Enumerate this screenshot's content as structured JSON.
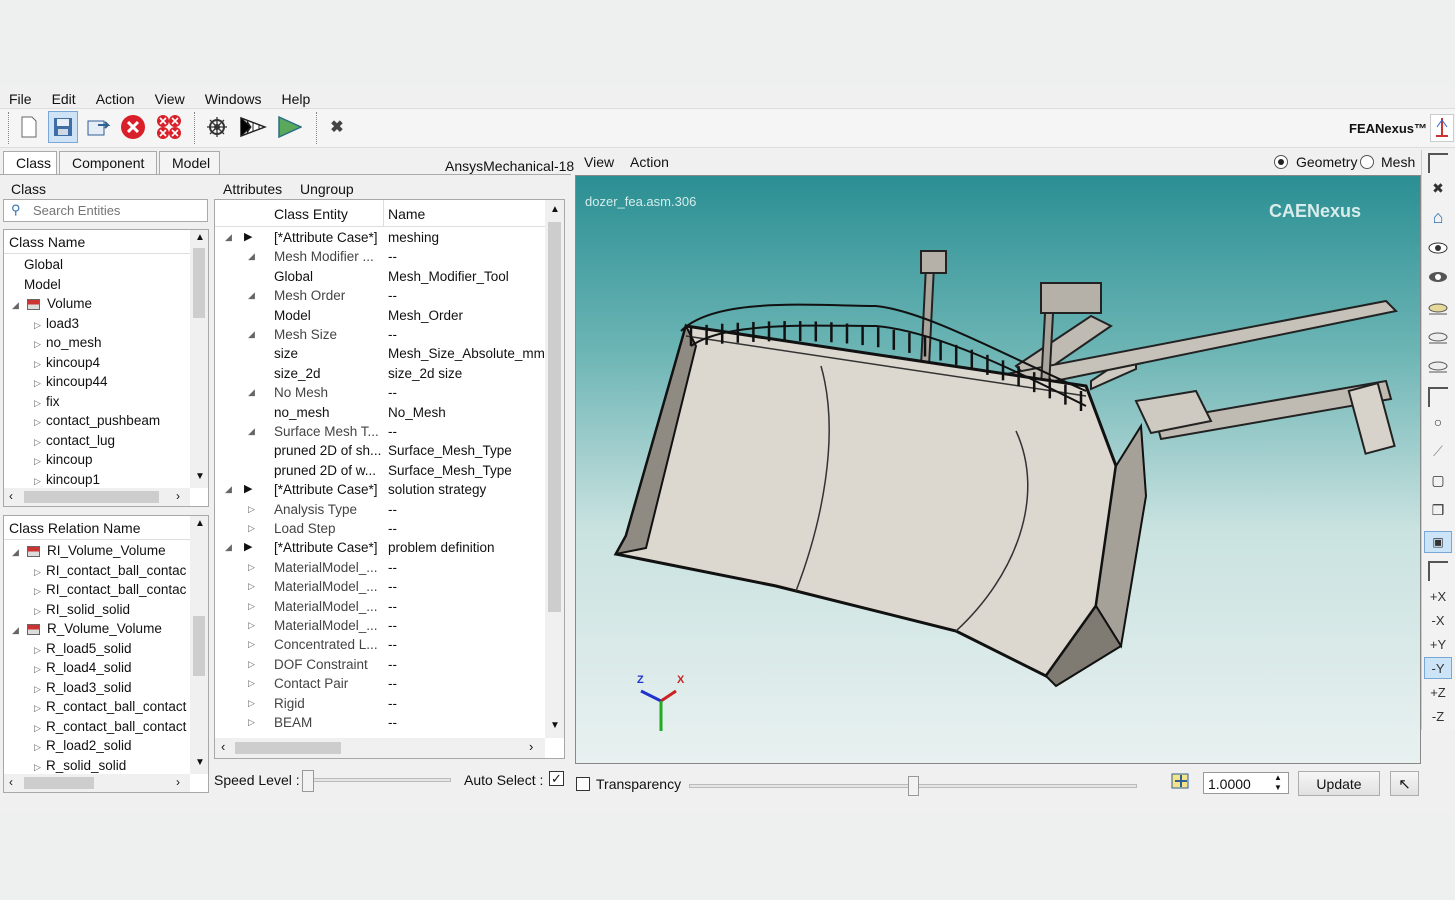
{
  "menu": [
    "File",
    "Edit",
    "Action",
    "View",
    "Windows",
    "Help"
  ],
  "brand": "FEANexus™",
  "tabs": [
    "Class",
    "Component",
    "Model"
  ],
  "solver": "AnsysMechanical-18",
  "class_panel": {
    "title": "Class",
    "search_placeholder": "Search Entities",
    "header": "Class Name",
    "items": [
      {
        "label": "Global",
        "level": 1,
        "expander": ""
      },
      {
        "label": "Model",
        "level": 1,
        "expander": ""
      },
      {
        "label": "Volume",
        "level": 1,
        "expander": "open",
        "icon": true
      },
      {
        "label": "load3",
        "level": 2,
        "expander": "closed"
      },
      {
        "label": "no_mesh",
        "level": 2,
        "expander": "closed"
      },
      {
        "label": "kincoup4",
        "level": 2,
        "expander": "closed"
      },
      {
        "label": "kincoup44",
        "level": 2,
        "expander": "closed"
      },
      {
        "label": "fix",
        "level": 2,
        "expander": "closed"
      },
      {
        "label": "contact_pushbeam",
        "level": 2,
        "expander": "closed"
      },
      {
        "label": "contact_lug",
        "level": 2,
        "expander": "closed"
      },
      {
        "label": "kincoup",
        "level": 2,
        "expander": "closed"
      },
      {
        "label": "kincoup1",
        "level": 2,
        "expander": "closed"
      }
    ]
  },
  "relation_panel": {
    "header": "Class Relation Name",
    "items": [
      {
        "label": "RI_Volume_Volume",
        "level": 1,
        "expander": "open",
        "icon": true
      },
      {
        "label": "RI_contact_ball_contac",
        "level": 2,
        "expander": "closed"
      },
      {
        "label": "RI_contact_ball_contac",
        "level": 2,
        "expander": "closed"
      },
      {
        "label": "RI_solid_solid",
        "level": 2,
        "expander": "closed"
      },
      {
        "label": "R_Volume_Volume",
        "level": 1,
        "expander": "open",
        "icon": true
      },
      {
        "label": "R_load5_solid",
        "level": 2,
        "expander": "closed"
      },
      {
        "label": "R_load4_solid",
        "level": 2,
        "expander": "closed"
      },
      {
        "label": "R_load3_solid",
        "level": 2,
        "expander": "closed"
      },
      {
        "label": "R_contact_ball_contact",
        "level": 2,
        "expander": "closed"
      },
      {
        "label": "R_contact_ball_contact",
        "level": 2,
        "expander": "closed"
      },
      {
        "label": "R_load2_solid",
        "level": 2,
        "expander": "closed"
      },
      {
        "label": "R_solid_solid",
        "level": 2,
        "expander": "closed"
      }
    ]
  },
  "attr_panel": {
    "menu": [
      "Attributes",
      "Ungroup"
    ],
    "col1": "Class Entity",
    "col2": "Name",
    "rows": [
      {
        "entity": "[*Attribute Case*]",
        "name": "meshing",
        "level": 0,
        "expander": "open",
        "play": true
      },
      {
        "entity": "Mesh Modifier ...",
        "name": "--",
        "level": 1,
        "expander": "open",
        "gray": true
      },
      {
        "entity": "Global",
        "name": "Mesh_Modifier_Tool",
        "level": 2,
        "expander": ""
      },
      {
        "entity": "Mesh Order",
        "name": "--",
        "level": 1,
        "expander": "open",
        "gray": true
      },
      {
        "entity": "Model",
        "name": "Mesh_Order",
        "level": 2,
        "expander": ""
      },
      {
        "entity": "Mesh Size",
        "name": "--",
        "level": 1,
        "expander": "open",
        "gray": true
      },
      {
        "entity": "size",
        "name": "Mesh_Size_Absolute_mm",
        "level": 2,
        "expander": ""
      },
      {
        "entity": "size_2d",
        "name": "size_2d size",
        "level": 2,
        "expander": ""
      },
      {
        "entity": "No Mesh",
        "name": "--",
        "level": 1,
        "expander": "open",
        "gray": true
      },
      {
        "entity": "no_mesh",
        "name": "No_Mesh",
        "level": 2,
        "expander": ""
      },
      {
        "entity": "Surface Mesh T...",
        "name": "--",
        "level": 1,
        "expander": "open",
        "gray": true
      },
      {
        "entity": "pruned 2D of sh...",
        "name": "Surface_Mesh_Type",
        "level": 2,
        "expander": ""
      },
      {
        "entity": "pruned 2D of w...",
        "name": "Surface_Mesh_Type",
        "level": 2,
        "expander": ""
      },
      {
        "entity": "[*Attribute Case*]",
        "name": "solution strategy",
        "level": 0,
        "expander": "open",
        "play": true
      },
      {
        "entity": "Analysis Type",
        "name": "--",
        "level": 1,
        "expander": "closed",
        "gray": true
      },
      {
        "entity": "Load Step",
        "name": "--",
        "level": 1,
        "expander": "closed",
        "gray": true
      },
      {
        "entity": "[*Attribute Case*]",
        "name": "problem definition",
        "level": 0,
        "expander": "open",
        "play": true
      },
      {
        "entity": "MaterialModel_...",
        "name": "--",
        "level": 1,
        "expander": "closed",
        "gray": true
      },
      {
        "entity": "MaterialModel_...",
        "name": "--",
        "level": 1,
        "expander": "closed",
        "gray": true
      },
      {
        "entity": "MaterialModel_...",
        "name": "--",
        "level": 1,
        "expander": "closed",
        "gray": true
      },
      {
        "entity": "MaterialModel_...",
        "name": "--",
        "level": 1,
        "expander": "closed",
        "gray": true
      },
      {
        "entity": "Concentrated L...",
        "name": "--",
        "level": 1,
        "expander": "closed",
        "gray": true
      },
      {
        "entity": "DOF Constraint",
        "name": "--",
        "level": 1,
        "expander": "closed",
        "gray": true
      },
      {
        "entity": "Contact Pair",
        "name": "--",
        "level": 1,
        "expander": "closed",
        "gray": true
      },
      {
        "entity": "Rigid",
        "name": "--",
        "level": 1,
        "expander": "closed",
        "gray": true
      },
      {
        "entity": "BEAM",
        "name": "--",
        "level": 1,
        "expander": "closed",
        "gray": true
      }
    ]
  },
  "speed_label": "Speed Level :",
  "auto_select_label": "Auto Select :",
  "auto_select": true,
  "viewer": {
    "menu": [
      "View",
      "Action"
    ],
    "mode_geometry": "Geometry",
    "mode_mesh": "Mesh",
    "selected": "Geometry",
    "model_name": "dozer_fea.asm.306",
    "watermark": "CAENexus",
    "axis_z": "Z",
    "axis_x": "X"
  },
  "bottom": {
    "transparency_label": "Transparency",
    "transparency": false,
    "slider_level": 0.5,
    "scale_value": "1.0000",
    "update_label": "Update"
  },
  "right_toolbar": [
    "+X",
    "-X",
    "+Y",
    "-Y",
    "+Z",
    "-Z"
  ],
  "colors": {
    "viewer_top": "#2a8f93",
    "viewer_bottom": "#e6f0ef",
    "accent": "#0078d7"
  }
}
